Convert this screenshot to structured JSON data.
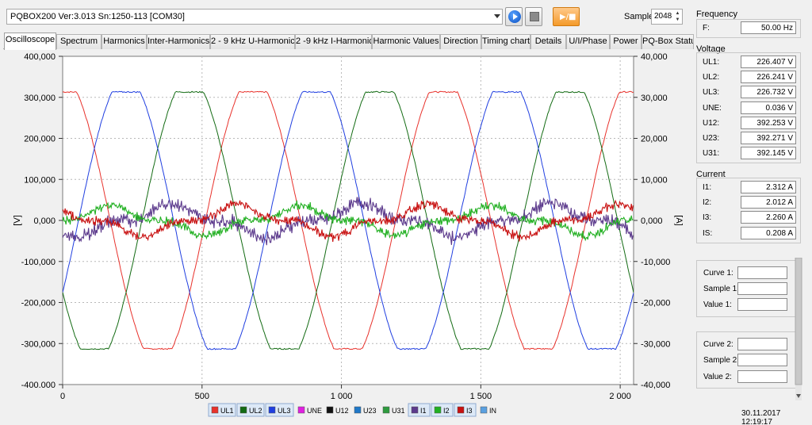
{
  "toolbar": {
    "device": "PQBOX200 Ver:3.013 Sn:1250-113 [COM30]",
    "sample_label": "Sample:",
    "sample_value": "2048",
    "icons": [
      "play-icon",
      "stop-icon",
      "play-pause-icon"
    ]
  },
  "tabs": [
    {
      "label": "Oscilloscope",
      "active": true
    },
    {
      "label": "Spectrum"
    },
    {
      "label": "Harmonics"
    },
    {
      "label": "Inter-Harmonics"
    },
    {
      "label": "2 - 9 kHz U-Harmonics"
    },
    {
      "label": "2 -9 kHz I-Harmonics"
    },
    {
      "label": "Harmonic Values"
    },
    {
      "label": "Direction"
    },
    {
      "label": "Timing chart"
    },
    {
      "label": "Details"
    },
    {
      "label": "U/I/Phase"
    },
    {
      "label": "Power"
    },
    {
      "label": "PQ-Box Status"
    }
  ],
  "panel": {
    "frequency": {
      "title": "Frequency",
      "rows": [
        {
          "label": "F:",
          "value": "50.00 Hz"
        }
      ]
    },
    "voltage": {
      "title": "Voltage",
      "rows": [
        {
          "label": "UL1:",
          "value": "226.407 V"
        },
        {
          "label": "UL2:",
          "value": "226.241 V"
        },
        {
          "label": "UL3:",
          "value": "226.732 V"
        },
        {
          "label": "UNE:",
          "value": "0.036 V"
        },
        {
          "label": "U12:",
          "value": "392.253 V"
        },
        {
          "label": "U23:",
          "value": "392.271 V"
        },
        {
          "label": "U31:",
          "value": "392.145 V"
        }
      ]
    },
    "current": {
      "title": "Current",
      "rows": [
        {
          "label": "I1:",
          "value": "2.312 A"
        },
        {
          "label": "I2:",
          "value": "2.012 A"
        },
        {
          "label": "I3:",
          "value": "2.260 A"
        },
        {
          "label": "IS:",
          "value": "0.208 A"
        }
      ]
    },
    "cursor1": {
      "rows": [
        {
          "label": "Curve 1:",
          "value": ""
        },
        {
          "label": "Sample 1:",
          "value": ""
        },
        {
          "label": "Value 1:",
          "value": ""
        }
      ]
    },
    "cursor2": {
      "rows": [
        {
          "label": "Curve 2:",
          "value": ""
        },
        {
          "label": "Sample 2:",
          "value": ""
        },
        {
          "label": "Value 2:",
          "value": ""
        }
      ]
    }
  },
  "status": {
    "datetime": "30.11.2017 12:19:17"
  },
  "chart_data": {
    "type": "line",
    "x": {
      "min": 0,
      "max": 2048,
      "ticks": [
        0,
        500,
        1000,
        1500,
        2000
      ],
      "tick_labels": [
        "0",
        "500",
        "1 000",
        "1 500",
        "2 000"
      ]
    },
    "y_left": {
      "label": "[V]",
      "min": -400000,
      "max": 400000,
      "ticks": [
        400000,
        300000,
        200000,
        100000,
        0,
        -100000,
        -200000,
        -300000,
        -400000
      ],
      "tick_labels": [
        "400,000",
        "300,000",
        "200,000",
        "100,000",
        "0,000",
        "-100,000",
        "-200,000",
        "-300,000",
        "-400.000"
      ]
    },
    "y_right": {
      "label": "[A]",
      "min": -40000,
      "max": 40000,
      "ticks": [
        40000,
        30000,
        20000,
        10000,
        0,
        -10000,
        -20000,
        -30000,
        -40000
      ],
      "tick_labels": [
        "40,000",
        "30,000",
        "20,000",
        "10,000",
        "0,000",
        "-10,000",
        "-20,000",
        "-30,000",
        "-40,000"
      ]
    },
    "grid": true,
    "legend_position": "bottom",
    "series": [
      {
        "name": "UL1",
        "color": "#e8312b",
        "checked": true,
        "axis": "left",
        "amplitude": 313000,
        "period": 682.7,
        "phase_deg": 0
      },
      {
        "name": "UL2",
        "color": "#136b13",
        "checked": true,
        "axis": "left",
        "amplitude": 313000,
        "period": 682.7,
        "phase_deg": 240
      },
      {
        "name": "UL3",
        "color": "#1f3ee0",
        "checked": true,
        "axis": "left",
        "amplitude": 313000,
        "period": 682.7,
        "phase_deg": 120
      },
      {
        "name": "UNE",
        "color": "#e020e0",
        "checked": false
      },
      {
        "name": "U12",
        "color": "#111111",
        "checked": false
      },
      {
        "name": "U23",
        "color": "#1f78c8",
        "checked": false
      },
      {
        "name": "U31",
        "color": "#2e9b3e",
        "checked": false
      },
      {
        "name": "I1",
        "color": "#5c3a8c",
        "checked": true,
        "axis": "right",
        "amplitude": 3200,
        "period": 682.7,
        "phase_deg": 205,
        "noise": 1200
      },
      {
        "name": "I2",
        "color": "#22b022",
        "checked": true,
        "axis": "right",
        "amplitude": 2800,
        "period": 682.7,
        "phase_deg": 90,
        "noise": 800
      },
      {
        "name": "I3",
        "color": "#c81010",
        "checked": true,
        "axis": "right",
        "amplitude": 3000,
        "period": 682.7,
        "phase_deg": 330,
        "noise": 800
      },
      {
        "name": "IN",
        "color": "#5aa0e0",
        "checked": false
      }
    ]
  }
}
